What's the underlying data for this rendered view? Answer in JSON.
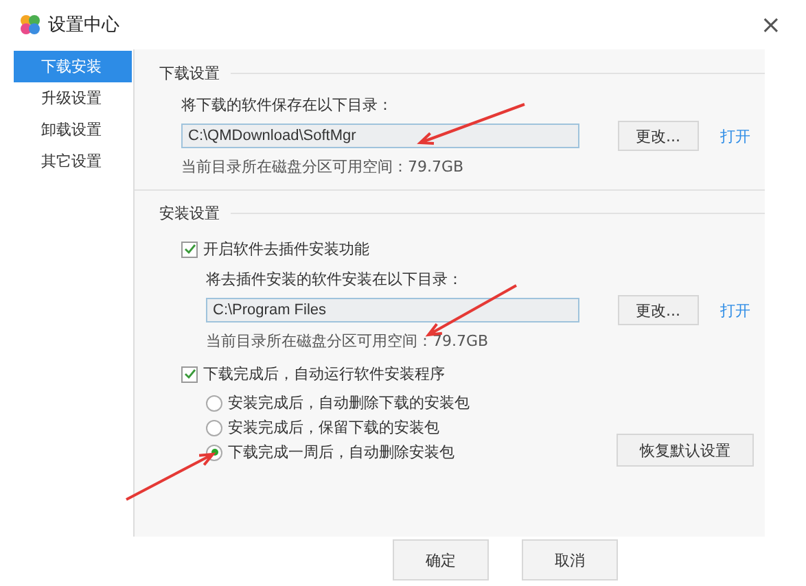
{
  "window": {
    "title": "设置中心",
    "close": "×"
  },
  "sidebar": {
    "items": [
      {
        "label": "下载安装",
        "selected": true
      },
      {
        "label": "升级设置",
        "selected": false
      },
      {
        "label": "卸载设置",
        "selected": false
      },
      {
        "label": "其它设置",
        "selected": false
      }
    ]
  },
  "download": {
    "heading": "下载设置",
    "prompt": "将下载的软件保存在以下目录：",
    "path": "C:\\QMDownload\\SoftMgr",
    "change": "更改...",
    "open": "打开",
    "space": "当前目录所在磁盘分区可用空间：79.7GB"
  },
  "install": {
    "heading": "安装设置",
    "plugin_free": {
      "label": "开启软件去插件安装功能",
      "checked": true
    },
    "prompt": "将去插件安装的软件安装在以下目录：",
    "path": "C:\\Program Files",
    "change": "更改...",
    "open": "打开",
    "space": "当前目录所在磁盘分区可用空间：79.7GB",
    "auto_run": {
      "label": "下载完成后，自动运行软件安装程序",
      "checked": true
    },
    "options": [
      {
        "label": "安装完成后，自动删除下载的安装包",
        "selected": false
      },
      {
        "label": "安装完成后，保留下载的安装包",
        "selected": false
      },
      {
        "label": "下载完成一周后，自动删除安装包",
        "selected": true
      }
    ],
    "restore": "恢复默认设置"
  },
  "buttons": [
    "确定",
    "取消"
  ]
}
